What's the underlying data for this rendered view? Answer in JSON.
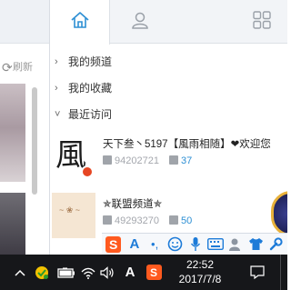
{
  "left_panel": {
    "refresh_label": "刷新",
    "refresh_icon": "refresh-icon"
  },
  "tabs": [
    {
      "icon": "home-icon",
      "active": true
    },
    {
      "icon": "person-icon",
      "active": false
    },
    {
      "icon": "apps-grid-icon",
      "active": false
    }
  ],
  "menu": {
    "favorites": "我的频道",
    "collection": "我的收藏",
    "recent": "最近访问"
  },
  "entries": [
    {
      "thumb_char": "風",
      "title": "天下叁丶5197【風雨相随】❤欢迎您",
      "id": "94202721",
      "count": "37"
    },
    {
      "thumb_char": "",
      "title": "✯联盟频道✯",
      "id": "49293270",
      "count": "50"
    }
  ],
  "ime_toolbar": {
    "letter": "A",
    "icons": [
      "sogou-icon",
      "letter-a-icon",
      "punctuation-icon",
      "emoji-icon",
      "microphone-icon",
      "keyboard-icon",
      "user-icon",
      "shirt-icon",
      "wrench-icon"
    ]
  },
  "taskbar": {
    "ime_letter": "A",
    "time": "22:52",
    "date": "2017/7/8"
  },
  "colors": {
    "accent_blue": "#2d8fd4",
    "sogou_orange": "#ff5a1f",
    "taskbar_bg": "#16171a"
  }
}
